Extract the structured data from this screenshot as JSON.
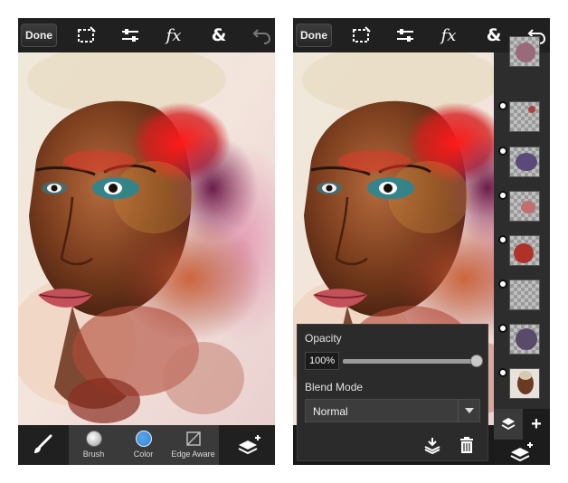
{
  "toolbar": {
    "done_label": "Done",
    "icons": [
      "selection-icon",
      "adjustments-icon",
      "effects-icon",
      "text-icon",
      "undo-icon"
    ],
    "fx_label": "fx",
    "amp_label": "&"
  },
  "bottom_tools": {
    "brush_label": "Brush",
    "color_label": "Color",
    "edge_aware_label": "Edge Aware",
    "brush_swatch_color": "#cfcfcf",
    "color_swatch_color": "#2f86d6"
  },
  "layers": {
    "count": 7,
    "add_label": "+"
  },
  "panel": {
    "opacity_label": "Opacity",
    "opacity_value": "100%",
    "opacity_level": 1.0,
    "blend_mode_label": "Blend Mode",
    "blend_mode_value": "Normal"
  },
  "colors": {
    "bar_bg": "#202020",
    "panel_bg": "#2b2b2b",
    "accent_blue": "#2f86d6"
  }
}
